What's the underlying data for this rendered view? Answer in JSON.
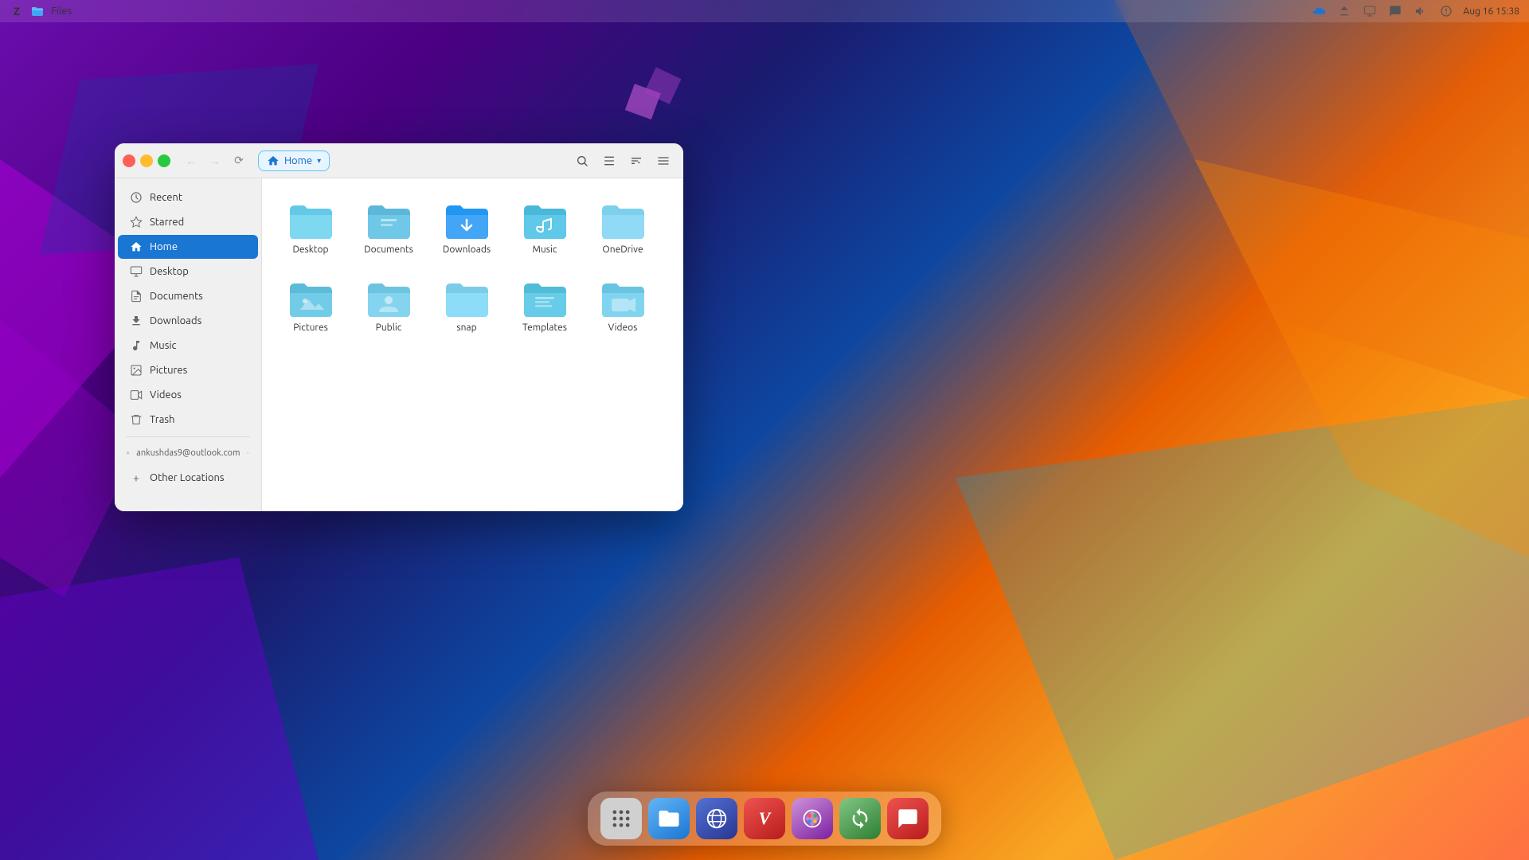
{
  "topbar": {
    "app_name": "Files",
    "date_time": "Aug 16  15:38"
  },
  "window": {
    "title": "Home",
    "location": "Home",
    "nav": {
      "back_label": "←",
      "forward_label": "→",
      "refresh_label": "⟳",
      "close_label": "✕",
      "minimize_label": "−",
      "maximize_label": "⊡"
    }
  },
  "sidebar": {
    "items": [
      {
        "id": "recent",
        "label": "Recent",
        "icon": "🕐"
      },
      {
        "id": "starred",
        "label": "Starred",
        "icon": "★"
      },
      {
        "id": "home",
        "label": "Home",
        "icon": "🏠",
        "active": true
      },
      {
        "id": "desktop",
        "label": "Desktop",
        "icon": "🖥"
      },
      {
        "id": "documents",
        "label": "Documents",
        "icon": "📄"
      },
      {
        "id": "downloads",
        "label": "Downloads",
        "icon": "⬇"
      },
      {
        "id": "music",
        "label": "Music",
        "icon": "🎵"
      },
      {
        "id": "pictures",
        "label": "Pictures",
        "icon": "🖼"
      },
      {
        "id": "videos",
        "label": "Videos",
        "icon": "🎬"
      },
      {
        "id": "trash",
        "label": "Trash",
        "icon": "🗑"
      }
    ],
    "account": {
      "email": "ankushdas9@outlook.com",
      "icon": "👤"
    },
    "other_locations": "Other Locations"
  },
  "files": {
    "folders": [
      {
        "name": "Desktop",
        "type": "normal"
      },
      {
        "name": "Documents",
        "type": "normal"
      },
      {
        "name": "Downloads",
        "type": "download"
      },
      {
        "name": "Music",
        "type": "music"
      },
      {
        "name": "OneDrive",
        "type": "normal"
      },
      {
        "name": "Pictures",
        "type": "pictures"
      },
      {
        "name": "Public",
        "type": "person"
      },
      {
        "name": "snap",
        "type": "normal"
      },
      {
        "name": "Templates",
        "type": "templates"
      },
      {
        "name": "Videos",
        "type": "videos"
      }
    ]
  },
  "dock": {
    "items": [
      {
        "id": "apps",
        "label": "⋮⋮⋮",
        "tooltip": "Show Applications"
      },
      {
        "id": "files",
        "label": "📁",
        "tooltip": "Files"
      },
      {
        "id": "browser",
        "label": "🌐",
        "tooltip": "Browser"
      },
      {
        "id": "vivaldi",
        "label": "V",
        "tooltip": "Vivaldi"
      },
      {
        "id": "colors",
        "label": "🎨",
        "tooltip": "Colors"
      },
      {
        "id": "update",
        "label": "🔄",
        "tooltip": "Update"
      },
      {
        "id": "speak",
        "label": "💬",
        "tooltip": "Speek"
      }
    ]
  },
  "icons": {
    "search": "🔍",
    "menu": "☰",
    "list_view": "≡",
    "sort": "↕",
    "home_icon": "🏠",
    "chevron_down": "▾",
    "close": "✕",
    "minimize": "−",
    "refresh": "⟳"
  }
}
